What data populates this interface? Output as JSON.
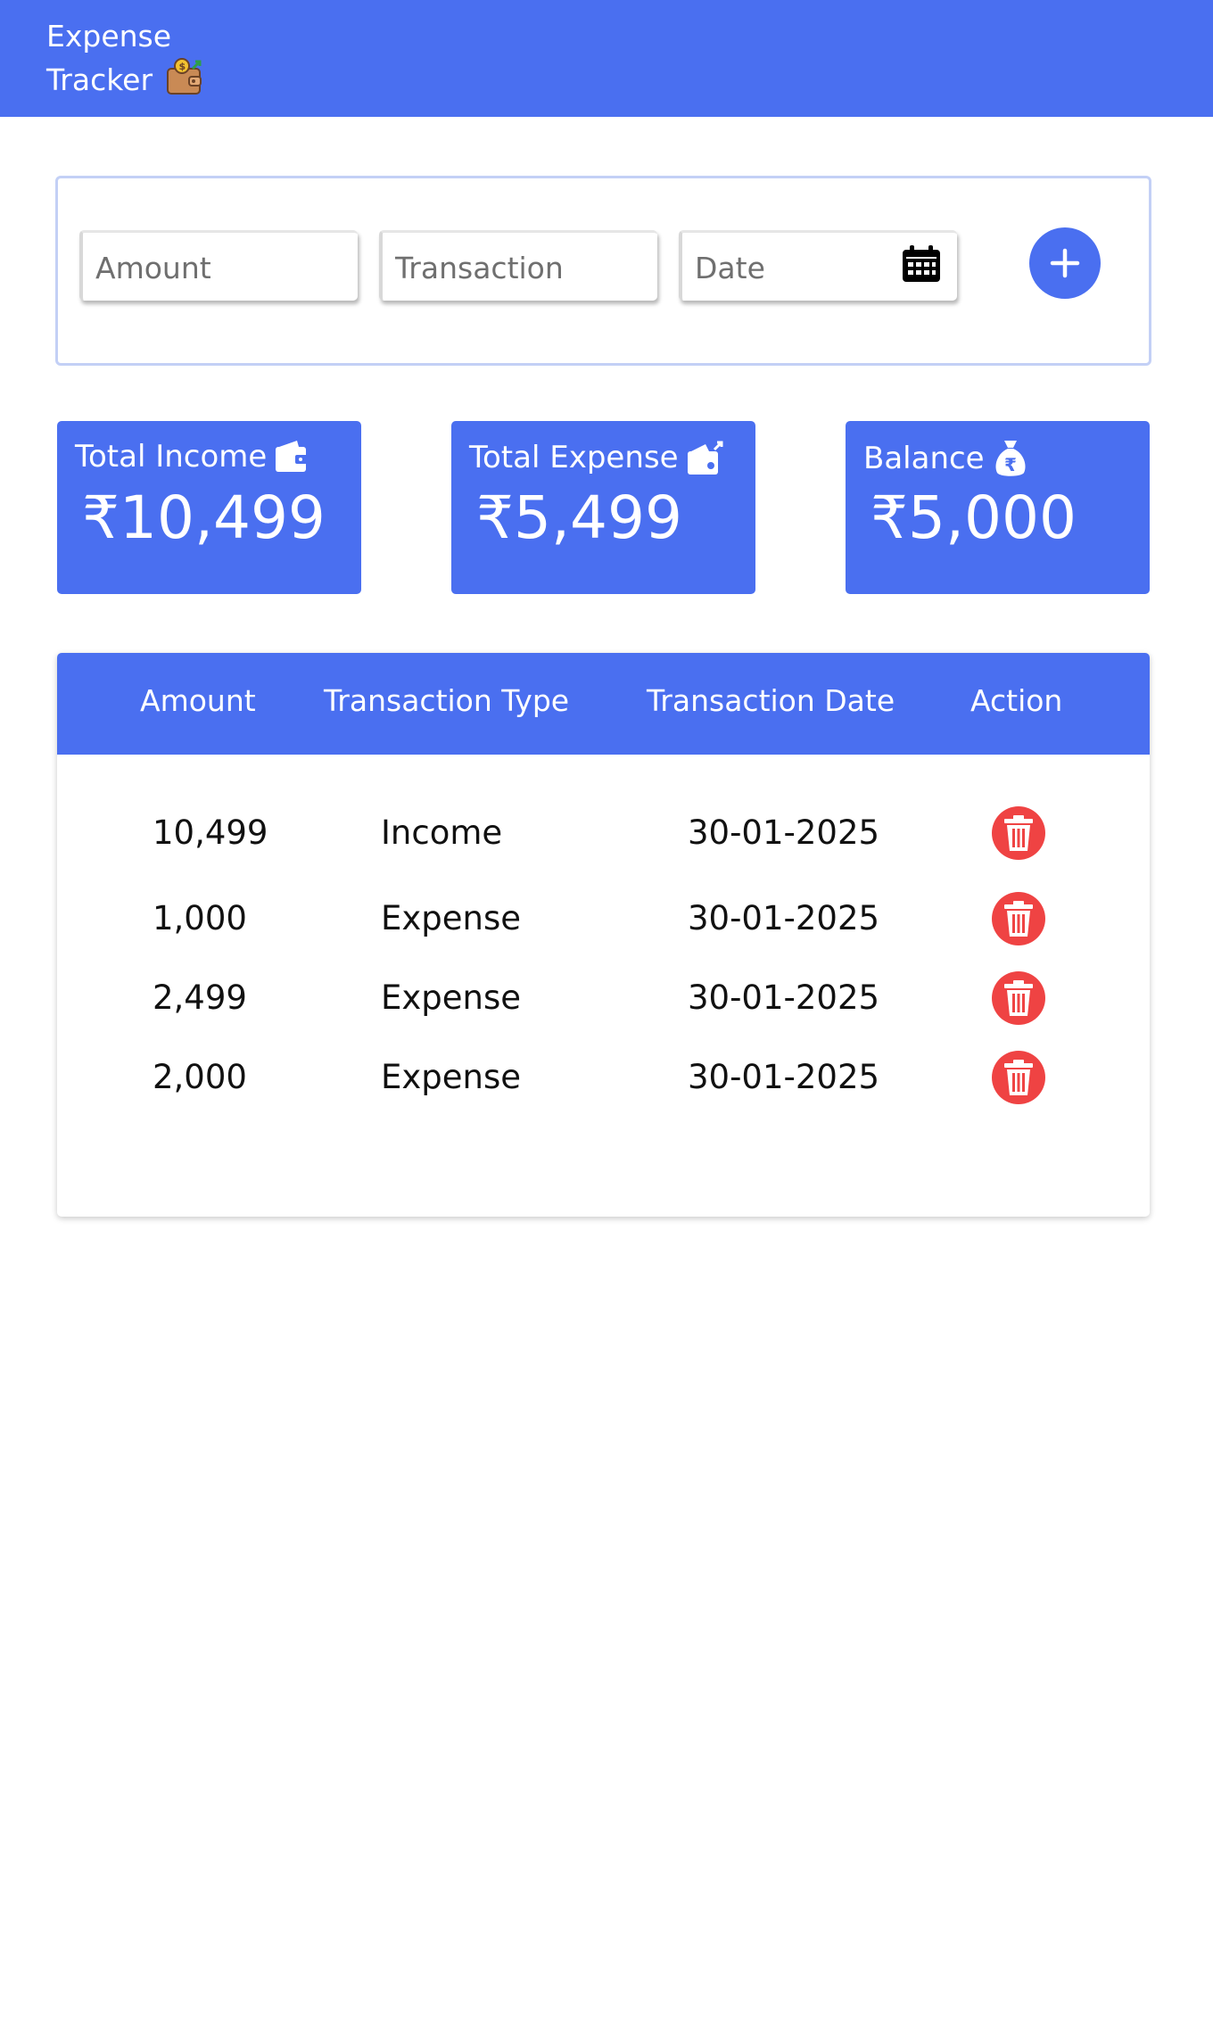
{
  "header": {
    "title_line1": "Expense",
    "title_line2": "Tracker",
    "logo_icon": "wallet-money-icon"
  },
  "form": {
    "amount_placeholder": "Amount",
    "transaction_placeholder": "Transaction",
    "date_placeholder": "Date",
    "calendar_icon": "calendar-icon",
    "add_icon": "plus-icon"
  },
  "stats": {
    "income": {
      "title": "Total Income",
      "value": "₹10,499",
      "icon": "wallet-icon"
    },
    "expense": {
      "title": "Total Expense",
      "value": "₹5,499",
      "icon": "wallet-out-icon"
    },
    "balance": {
      "title": "Balance",
      "value": "₹5,000",
      "icon": "money-bag-icon"
    }
  },
  "table": {
    "headers": [
      "Amount",
      "Transaction Type",
      "Transaction Date",
      "Action"
    ],
    "rows": [
      {
        "amount": "10,499",
        "type": "Income",
        "date": "30-01-2025"
      },
      {
        "amount": "1,000",
        "type": "Expense",
        "date": "30-01-2025"
      },
      {
        "amount": "2,499",
        "type": "Expense",
        "date": "30-01-2025"
      },
      {
        "amount": "2,000",
        "type": "Expense",
        "date": "30-01-2025"
      }
    ],
    "delete_icon": "trash-icon"
  },
  "colors": {
    "primary": "#4a6ff0",
    "danger": "#ef4343",
    "white": "#ffffff"
  }
}
